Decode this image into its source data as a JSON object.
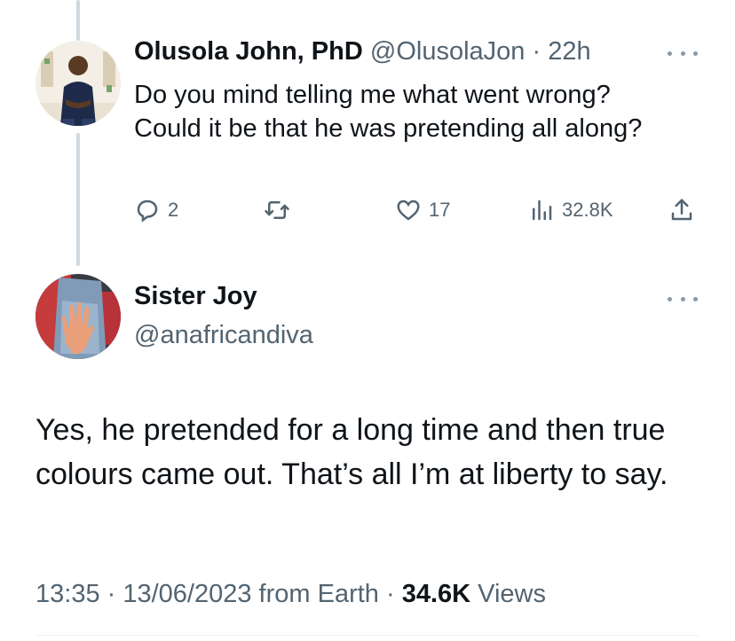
{
  "parent_tweet": {
    "author_name": "Olusola John, PhD",
    "handle": "@OlusolaJon",
    "separator": "·",
    "time": "22h",
    "text": "Do you mind telling me what went wrong? Could it be that he was pretending all along?",
    "replies": "2",
    "retweets": "",
    "likes": "17",
    "views": "32.8K"
  },
  "main_tweet": {
    "author_name": "Sister Joy",
    "handle": "@anafricandiva",
    "text": "Yes, he pretended for a long time and then true colours came out. That’s all I’m at liberty to say.",
    "timestamp": "13:35 · 13/06/2023 from Earth",
    "separator": "·",
    "views_count": "34.6K",
    "views_label": "Views"
  },
  "icons": {
    "reply": "reply-icon",
    "retweet": "retweet-icon",
    "like": "heart-icon",
    "views": "analytics-icon",
    "share": "share-icon",
    "more": "more-icon"
  },
  "colors": {
    "text_primary": "#0f1419",
    "text_secondary": "#536471",
    "thread_line": "#cfd9de"
  }
}
